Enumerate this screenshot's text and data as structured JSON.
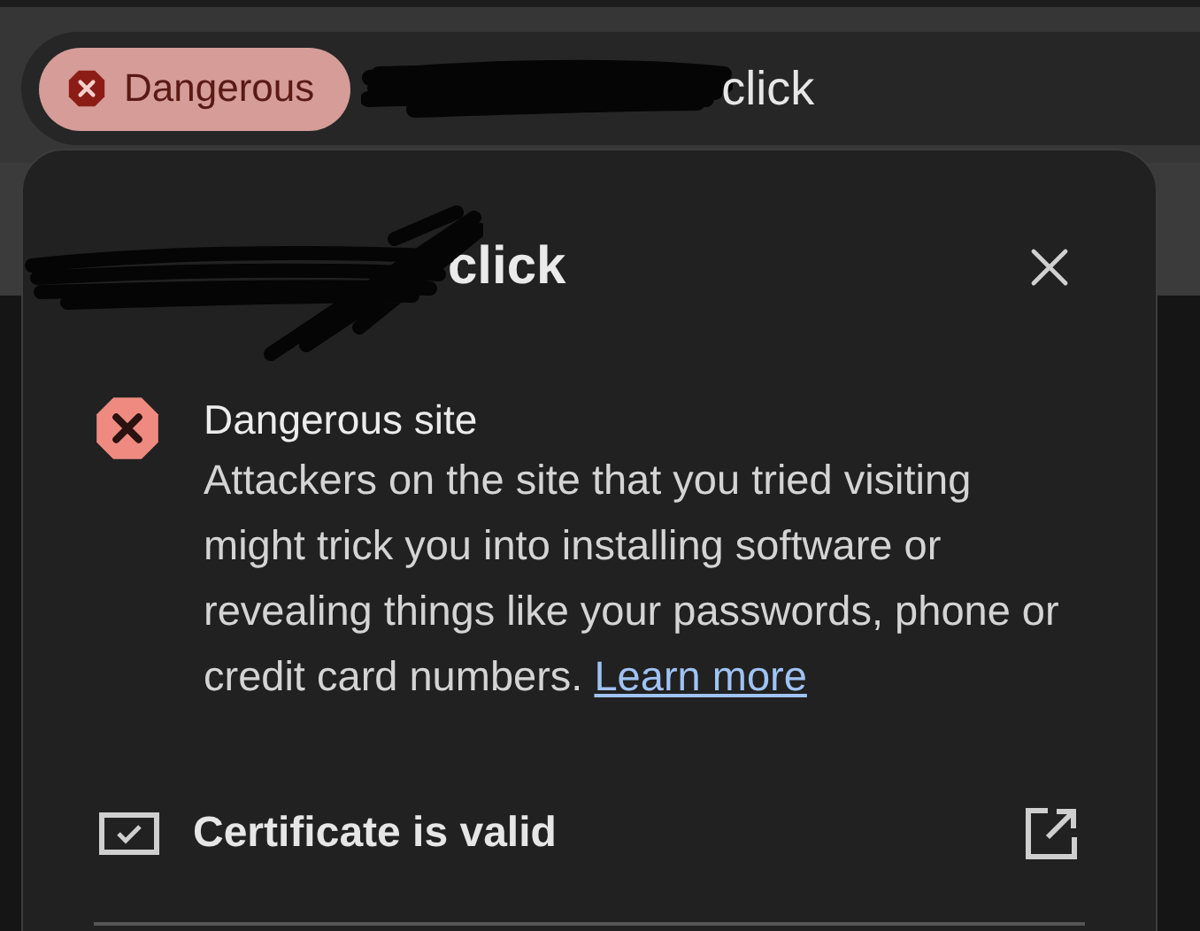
{
  "omnibox": {
    "security_chip": {
      "kind": "dangerous",
      "label": "Dangerous"
    },
    "url_visible": "click"
  },
  "popup": {
    "title_visible": "click",
    "warning": {
      "kind": "dangerous",
      "title": "Dangerous site",
      "body": "Attackers on the site that you tried visiting might trick you into installing software or revealing things like your passwords, phone or credit card numbers.",
      "link": "Learn more"
    },
    "rows": [
      {
        "kind": "certificate",
        "label": "Certificate is valid"
      }
    ]
  }
}
